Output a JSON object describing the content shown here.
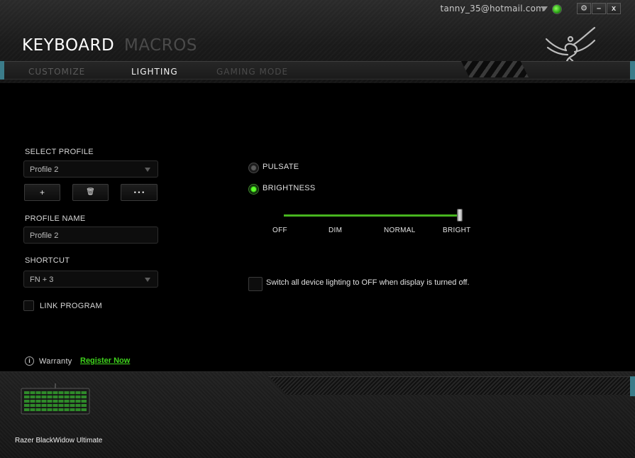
{
  "header": {
    "account_email": "tanny_35@hotmail.com",
    "window_controls": {
      "settings": "⚙",
      "minimize": "–",
      "close": "x"
    },
    "main_tabs": [
      {
        "label": "KEYBOARD",
        "active": true
      },
      {
        "label": "MACROS",
        "active": false
      }
    ],
    "sub_tabs": [
      {
        "label": "CUSTOMIZE",
        "active": false
      },
      {
        "label": "LIGHTING",
        "active": true
      },
      {
        "label": "GAMING MODE",
        "active": false
      }
    ],
    "logo_icon": "razer-snake-icon"
  },
  "profile": {
    "select_label": "SELECT PROFILE",
    "selected": "Profile 2",
    "buttons": {
      "add": "+",
      "delete": "🗑",
      "more": "• • •"
    },
    "name_label": "PROFILE NAME",
    "name_value": "Profile 2",
    "shortcut_label": "SHORTCUT",
    "shortcut_value": "FN + 3",
    "link_program_label": "LINK PROGRAM",
    "link_program_checked": false
  },
  "warranty": {
    "icon": "info-icon",
    "label": "Warranty",
    "link": "Register Now"
  },
  "lighting": {
    "effects": [
      {
        "label": "PULSATE",
        "selected": false
      },
      {
        "label": "BRIGHTNESS",
        "selected": true
      }
    ],
    "brightness_levels": [
      "OFF",
      "DIM",
      "NORMAL",
      "BRIGHT"
    ],
    "brightness_value": "BRIGHT",
    "display_off_label": "Switch all device lighting to OFF when display is turned off.",
    "display_off_checked": false
  },
  "device": {
    "name": "Razer BlackWidow Ultimate"
  },
  "colors": {
    "accent_green": "#44d62c",
    "link_green": "#3fd41c",
    "background": "#000000"
  }
}
